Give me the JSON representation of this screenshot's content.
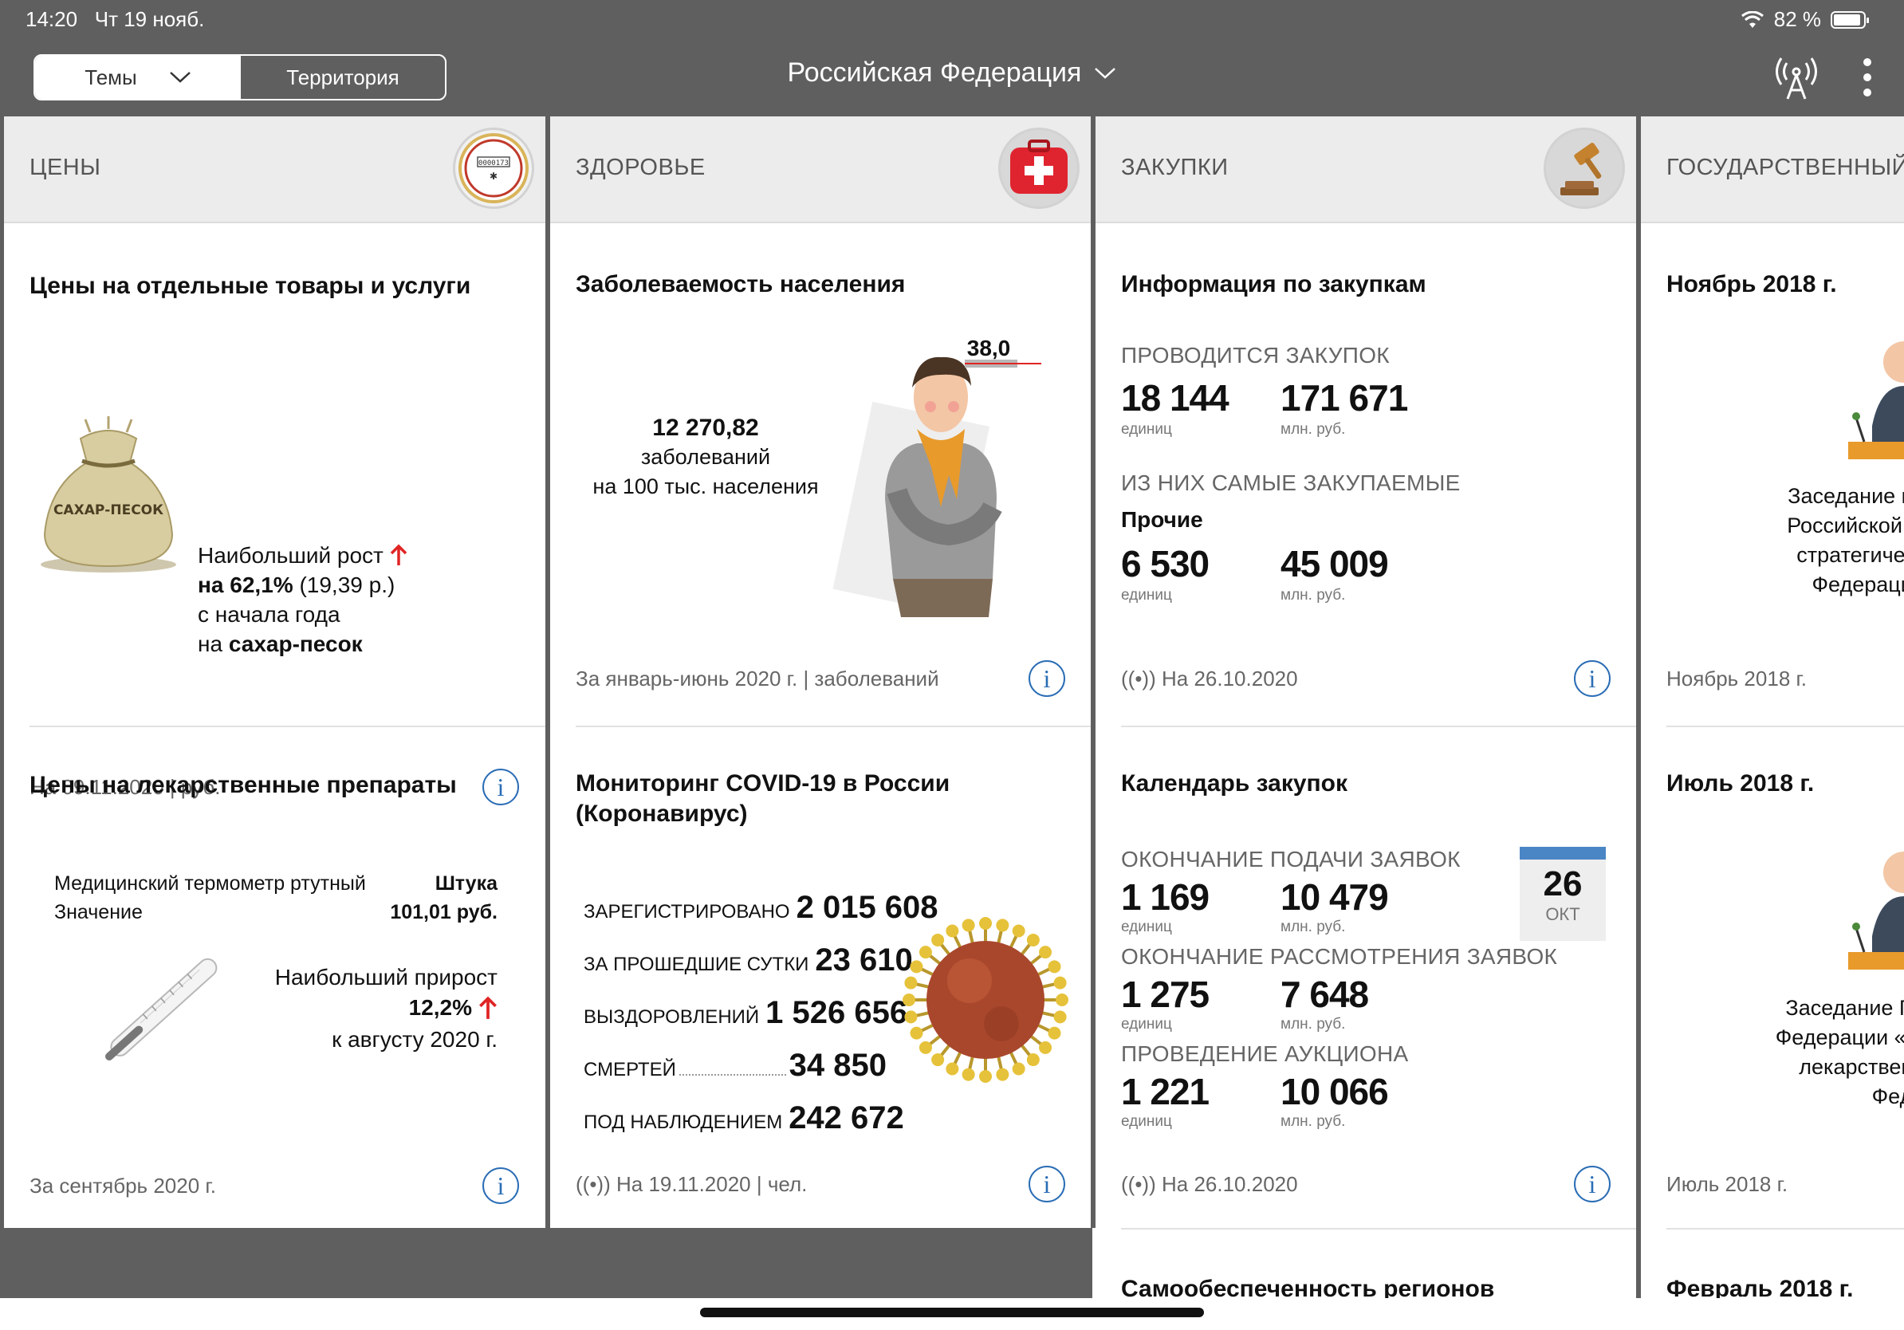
{
  "status_bar": {
    "time": "14:20",
    "date": "Чт 19 нояб.",
    "battery": "82 %"
  },
  "topbar": {
    "segment_left": "Темы",
    "segment_right": "Территория",
    "region": "Российская Федерация"
  },
  "prices": {
    "title": "ЦЕНЫ",
    "card1": {
      "title": "Цены на отдельные товары и услуги",
      "bag_label": "САХАР-ПЕСОК",
      "growth_label": "Наибольший рост",
      "growth_prefix": "на",
      "growth_value": "62,1%",
      "growth_abs": "(19,39 р.)",
      "since": "с начала года",
      "product_prefix": "на",
      "product": "сахар-песок",
      "footer": "На 09.11.2020 | руб."
    },
    "card2": {
      "title": "Цены на лекарственные препараты",
      "item_name": "Медицинский термометр ртутный",
      "item_unit": "Штука",
      "value_label": "Значение",
      "value": "101,01 руб.",
      "growth_label": "Наибольший прирост",
      "growth_value": "12,2%",
      "growth_period": "к августу 2020 г.",
      "footer": "За сентябрь 2020 г."
    }
  },
  "health": {
    "title": "ЗДОРОВЬЕ",
    "card1": {
      "title": "Заболеваемость населения",
      "value": "12 270,82",
      "line1": "заболеваний",
      "line2": "на 100 тыс. населения",
      "temperature": "38,0",
      "footer": "За январь-июнь 2020 г. | заболеваний"
    },
    "card2": {
      "title_line1": "Мониторинг COVID-19 в России",
      "title_line2": "(Коронавирус)",
      "rows": [
        {
          "label": "ЗАРЕГИСТРИРОВАНО",
          "value": "2 015 608"
        },
        {
          "label": "ЗА ПРОШЕДШИЕ СУТКИ",
          "value": "23 610"
        },
        {
          "label": "ВЫЗДОРОВЛЕНИЙ",
          "value": "1 526 656"
        },
        {
          "label": "СМЕРТЕЙ",
          "value": "34 850"
        },
        {
          "label": "ПОД НАБЛЮДЕНИЕМ",
          "value": "242 672"
        }
      ],
      "footer": "На 19.11.2020 | чел."
    }
  },
  "procurement": {
    "title": "ЗАКУПКИ",
    "card1": {
      "title": "Информация по закупкам",
      "section1": "ПРОВОДИТСЯ ЗАКУПОК",
      "count1": "18 144",
      "count1_unit": "единиц",
      "sum1": "171 671",
      "sum1_unit": "млн. руб.",
      "section2": "ИЗ НИХ САМЫЕ ЗАКУПАЕМЫЕ",
      "category": "Прочие",
      "count2": "6 530",
      "count2_unit": "единиц",
      "sum2": "45 009",
      "sum2_unit": "млн. руб.",
      "footer": "На 26.10.2020"
    },
    "card2": {
      "title": "Календарь закупок",
      "calendar_day": "26",
      "calendar_month": "ОКТ",
      "rows": [
        {
          "label": "ОКОНЧАНИЕ ПОДАЧИ ЗАЯВОК",
          "count": "1 169",
          "count_unit": "единиц",
          "sum": "10 479",
          "sum_unit": "млн. руб."
        },
        {
          "label": "ОКОНЧАНИЕ РАССМОТРЕНИЯ ЗАЯВОК",
          "count": "1 275",
          "count_unit": "единиц",
          "sum": "7 648",
          "sum_unit": "млн. руб."
        },
        {
          "label": "ПРОВЕДЕНИЕ АУКЦИОНА",
          "count": "1 221",
          "count_unit": "единиц",
          "sum": "10 066",
          "sum_unit": "млн. руб."
        }
      ],
      "footer": "На 26.10.2020"
    },
    "card3": {
      "title": "Самообеспеченность регионов"
    }
  },
  "state_council": {
    "title": "ГОСУДАРСТВЕННЫЙ СОВЕТ",
    "card1": {
      "title": "Ноябрь 2018 г.",
      "text_lines": [
        "Заседание президиума",
        "Российской Федерации",
        "стратегических задач",
        "Федерации на пер"
      ],
      "footer": "Ноябрь 2018 г."
    },
    "card2": {
      "title": "Июль 2018 г.",
      "text_lines": [
        "Заседание Государстве",
        "Федерации «О повышени",
        "лекарственного обес",
        "Федер"
      ],
      "footer": "Июль 2018 г."
    },
    "card3": {
      "title": "Февраль 2018 г."
    }
  },
  "icons": {
    "live_icon": "((•))",
    "info_icon": "i"
  },
  "colors": {
    "topbar": "#5f5f5f",
    "accent_blue": "#2a6db5",
    "arrow_red": "#e02424",
    "header_bg": "#ececec"
  }
}
